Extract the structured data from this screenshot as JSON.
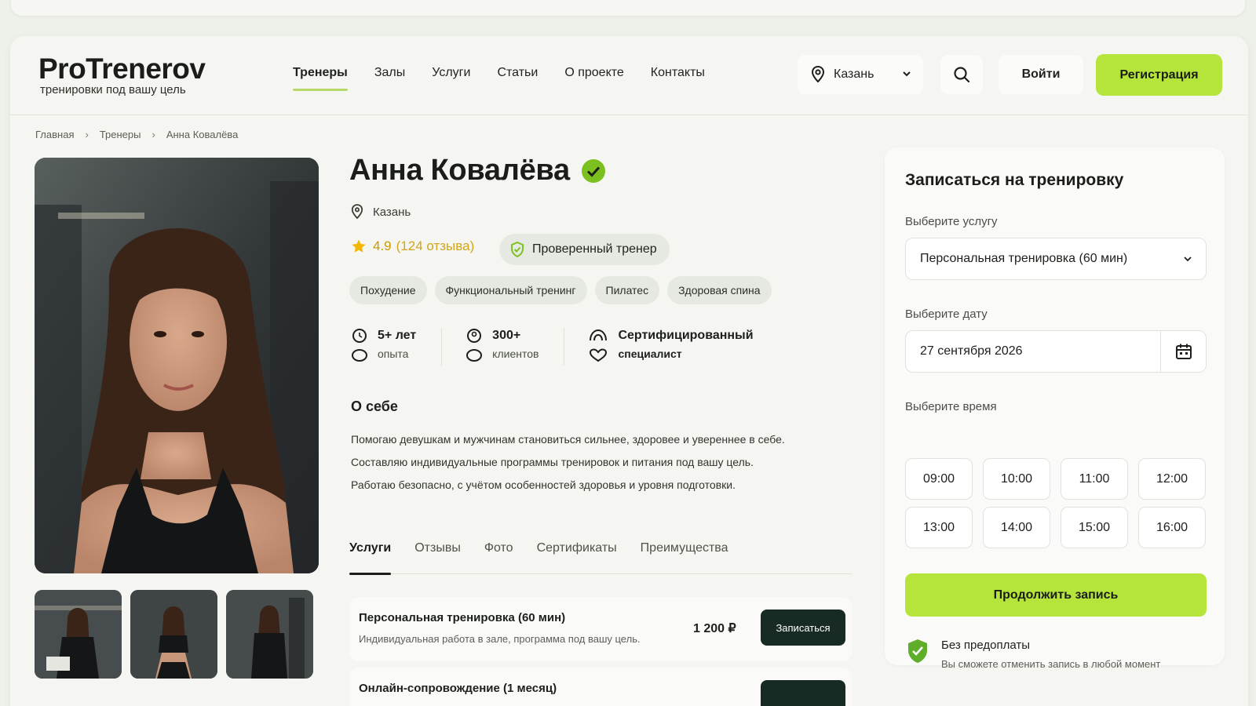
{
  "header": {
    "logo_title": "ProTrenerov",
    "logo_subtitle": "тренировки под вашу цель",
    "nav": [
      "Тренеры",
      "Залы",
      "Услуги",
      "Статьи",
      "О проекте",
      "Контакты"
    ],
    "city": "Казань",
    "login": "Войти",
    "register": "Регистрация"
  },
  "breadcrumb": [
    "Главная",
    "Тренеры",
    "Анна Ковалёва"
  ],
  "trainer": {
    "name": "Анна Ковалёва",
    "city": "Казань",
    "rating": "4.9",
    "reviews": "(124 отзыва)",
    "verified_label": "Проверенный тренер",
    "tags": [
      "Похудение",
      "Функциональный тренинг",
      "Пилатес",
      "Здоровая спина"
    ],
    "stats": [
      {
        "value": "5+ лет",
        "label": "опыта"
      },
      {
        "value": "300+",
        "label": "клиентов"
      },
      {
        "value": "Сертифицированный",
        "label": "специалист"
      }
    ],
    "about_title": "О себе",
    "about_lines": [
      "Помогаю девушкам и мужчинам становиться сильнее, здоровее и увереннее в себе.",
      "Составляю индивидуальные программы тренировок и питания под вашу цель.",
      "Работаю безопасно, с учётом особенностей здоровья и уровня подготовки."
    ]
  },
  "tabs": [
    "Услуги",
    "Отзывы",
    "Фото",
    "Сертификаты",
    "Преимущества"
  ],
  "services": [
    {
      "name": "Персональная тренировка (60 мин)",
      "desc": "Индивидуальная работа в зале, программа под вашу цель.",
      "price": "1 200 ₽",
      "button": "Записаться"
    },
    {
      "name": "Онлайн-сопровождение (1 месяц)",
      "desc": "",
      "price": "",
      "button": ""
    }
  ],
  "booking": {
    "title": "Записаться на тренировку",
    "service_label": "Выберите услугу",
    "service_value": "Персональная тренировка (60 мин)",
    "date_label": "Выберите дату",
    "date_value": "27 сентября 2026",
    "time_label": "Выберите время",
    "slots": [
      "09:00",
      "10:00",
      "11:00",
      "12:00",
      "13:00",
      "14:00",
      "15:00",
      "16:00"
    ],
    "continue": "Продолжить запись",
    "note_title": "Без предоплаты",
    "note_sub": "Вы сможете отменить запись в любой момент"
  },
  "colors": {
    "accent": "#b5e43a",
    "dark_button": "#172a23",
    "rating": "#e3a800",
    "verified": "#7cc01f"
  }
}
